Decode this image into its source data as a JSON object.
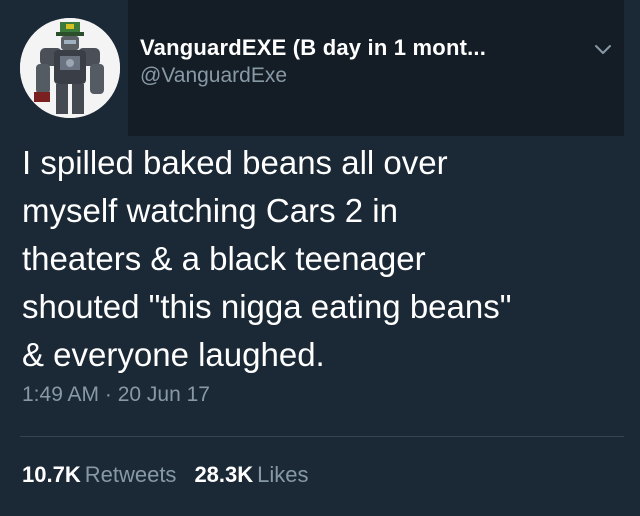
{
  "tweet": {
    "author": {
      "display_name": "VanguardEXE (B day in 1 mont...",
      "handle": "@VanguardExe",
      "avatar_icon": "robot-avatar-icon"
    },
    "menu_icon": "chevron-down-icon",
    "text_lines": [
      "I spilled baked beans all over",
      "myself watching Cars 2 in",
      "theaters & a black teenager",
      "shouted \"this nigga eating beans\"",
      "& everyone laughed."
    ],
    "timestamp": "1:49 AM · 20 Jun 17",
    "retweets": {
      "count": "10.7K",
      "label": "Retweets"
    },
    "likes": {
      "count": "28.3K",
      "label": "Likes"
    }
  },
  "colors": {
    "background": "#1b2836",
    "header_panel": "#141d26",
    "text_primary": "#ffffff",
    "text_secondary": "#8899a6",
    "divider": "#38444d"
  }
}
